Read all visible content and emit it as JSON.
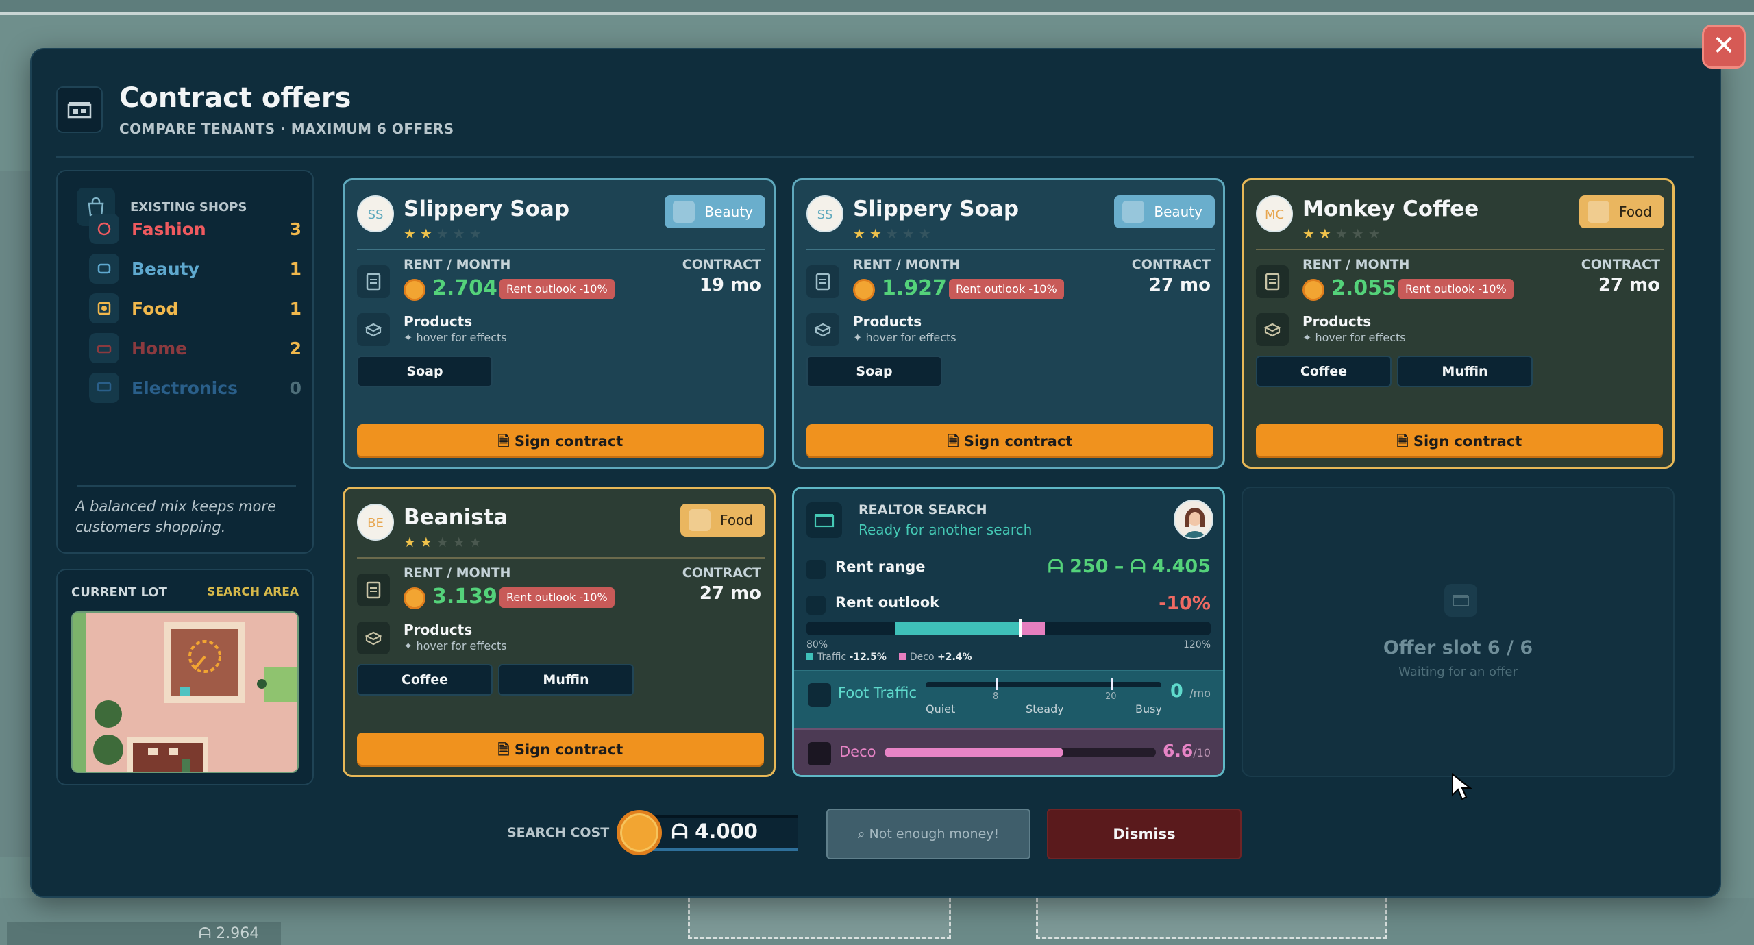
{
  "modal": {
    "title": "Contract offers",
    "subtitle": "COMPARE TENANTS · MAXIMUM 6 OFFERS",
    "close": "✕"
  },
  "shops": {
    "header": "EXISTING SHOPS",
    "items": [
      {
        "label": "Fashion",
        "count": "3",
        "color": "#ef5a5f"
      },
      {
        "label": "Beauty",
        "count": "1",
        "color": "#5fa9cf"
      },
      {
        "label": "Food",
        "count": "1",
        "color": "#f1b84c"
      },
      {
        "label": "Home",
        "count": "2",
        "color": "#8b3a3f"
      },
      {
        "label": "Electronics",
        "count": "0",
        "color": "#2a5f8a"
      }
    ],
    "note": "A balanced mix keeps more customers shopping."
  },
  "lot": {
    "label": "CURRENT LOT",
    "area_link": "SEARCH AREA"
  },
  "offers": [
    {
      "initials": "SS",
      "name": "Slippery Soap",
      "stars": 2,
      "max_stars": 5,
      "category": "Beauty",
      "rent_label": "RENT / MONTH",
      "rent": "2.704",
      "outlook": "Rent outlook -10%",
      "contract_label": "CONTRACT",
      "contract": "19 mo",
      "products_label": "Products",
      "hover_label": "✦ hover for effects",
      "products": [
        "Soap"
      ],
      "sign_label": "Sign contract"
    },
    {
      "initials": "SS",
      "name": "Slippery Soap",
      "stars": 2,
      "max_stars": 5,
      "category": "Beauty",
      "rent_label": "RENT / MONTH",
      "rent": "1.927",
      "outlook": "Rent outlook -10%",
      "contract_label": "CONTRACT",
      "contract": "27 mo",
      "products_label": "Products",
      "hover_label": "✦ hover for effects",
      "products": [
        "Soap"
      ],
      "sign_label": "Sign contract"
    },
    {
      "initials": "MC",
      "name": "Monkey Coffee",
      "stars": 2,
      "max_stars": 5,
      "category": "Food",
      "rent_label": "RENT / MONTH",
      "rent": "2.055",
      "outlook": "Rent outlook -10%",
      "contract_label": "CONTRACT",
      "contract": "27 mo",
      "products_label": "Products",
      "hover_label": "✦ hover for effects",
      "products": [
        "Coffee",
        "Muffin"
      ],
      "sign_label": "Sign contract"
    },
    {
      "initials": "BE",
      "name": "Beanista",
      "stars": 2,
      "max_stars": 5,
      "category": "Food",
      "rent_label": "RENT / MONTH",
      "rent": "3.139",
      "outlook": "Rent outlook -10%",
      "contract_label": "CONTRACT",
      "contract": "27 mo",
      "products_label": "Products",
      "hover_label": "✦ hover for effects",
      "products": [
        "Coffee",
        "Muffin"
      ],
      "sign_label": "Sign contract"
    }
  ],
  "realtor": {
    "title": "REALTOR SEARCH",
    "status": "Ready for another search",
    "rent_range_label": "Rent range",
    "rent_range": "ᗩ 250 – ᗩ 4.405",
    "rent_outlook_label": "Rent outlook",
    "rent_outlook": "-10%",
    "bar_min": "80%",
    "bar_max": "120%",
    "legend_traffic_label": "Traffic",
    "legend_traffic": "-12.5%",
    "legend_deco_label": "Deco",
    "legend_deco": "+2.4%",
    "foot_traffic_label": "Foot Traffic",
    "traffic_tick_1": "8",
    "traffic_tick_2": "20",
    "traffic_quiet": "Quiet",
    "traffic_steady": "Steady",
    "traffic_busy": "Busy",
    "foot_traffic_value": "0",
    "foot_traffic_unit": "/mo",
    "deco_label": "Deco",
    "deco_value": "6.6",
    "deco_unit": "/10",
    "deco_level": 0.66
  },
  "empty_slot": {
    "title": "Offer slot 6 / 6",
    "subtitle": "Waiting for an offer"
  },
  "footer": {
    "search_cost_label": "SEARCH COST",
    "search_cost": "ᗩ 4.000",
    "not_enough": "Not enough money!",
    "dismiss": "Dismiss"
  },
  "background": {
    "money": "ᗩ 2.964"
  }
}
